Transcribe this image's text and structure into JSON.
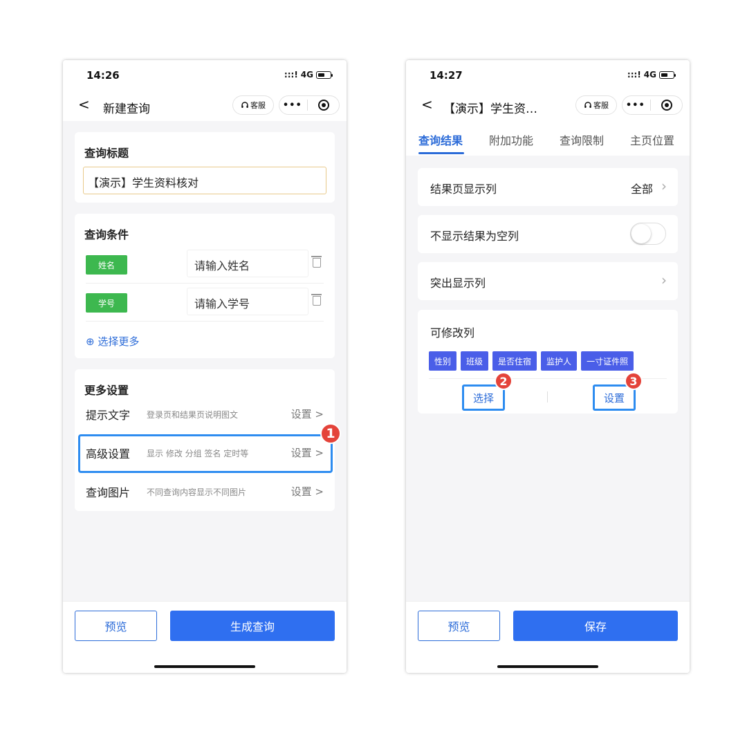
{
  "left_phone": {
    "status": {
      "time": "14:26",
      "signal": ":::!",
      "network": "4G"
    },
    "nav": {
      "back": "<",
      "title": "新建查询",
      "service": "客服",
      "more": "•••"
    },
    "title_card": {
      "heading": "查询标题",
      "value": "【演示】学生资料核对"
    },
    "conditions": {
      "heading": "查询条件",
      "rows": [
        {
          "tag": "姓名",
          "placeholder": "请输入姓名"
        },
        {
          "tag": "学号",
          "placeholder": "请输入学号"
        }
      ],
      "select_more": "⊕ 选择更多"
    },
    "more_settings": {
      "heading": "更多设置",
      "rows": [
        {
          "label": "提示文字",
          "desc": "登录页和结果页说明图文",
          "action": "设置 >"
        },
        {
          "label": "高级设置",
          "desc": "显示 修改 分组 签名 定时等",
          "action": "设置 >"
        },
        {
          "label": "查询图片",
          "desc": "不同查询内容显示不同图片",
          "action": "设置 >"
        }
      ]
    },
    "footer": {
      "preview": "预览",
      "generate": "生成查询"
    },
    "badge": "1"
  },
  "right_phone": {
    "status": {
      "time": "14:27",
      "signal": ":::!",
      "network": "4G"
    },
    "nav": {
      "back": "<",
      "title": "【演示】学生资…",
      "service": "客服",
      "more": "•••"
    },
    "tabs": [
      "查询结果",
      "附加功能",
      "查询限制",
      "主页位置"
    ],
    "active_tab": "查询结果",
    "result_columns": {
      "label": "结果页显示列",
      "value": "全部"
    },
    "hide_empty": {
      "label": "不显示结果为空列",
      "enabled": false
    },
    "highlight_columns": {
      "label": "突出显示列"
    },
    "editable_columns": {
      "heading": "可修改列",
      "chips": [
        "性别",
        "班级",
        "是否住宿",
        "监护人",
        "一寸证件照"
      ],
      "select_button": "选择",
      "settings_button": "设置"
    },
    "footer": {
      "preview": "预览",
      "save": "保存"
    },
    "badges": [
      "2",
      "3"
    ]
  },
  "colors": {
    "accent": "#2b6bd8",
    "primary_button": "#2f6ff0",
    "tag_green": "#3db84f",
    "chip_blue": "#4a5ee8",
    "badge_red": "#e4433a",
    "highlight": "#2d8cf0"
  }
}
